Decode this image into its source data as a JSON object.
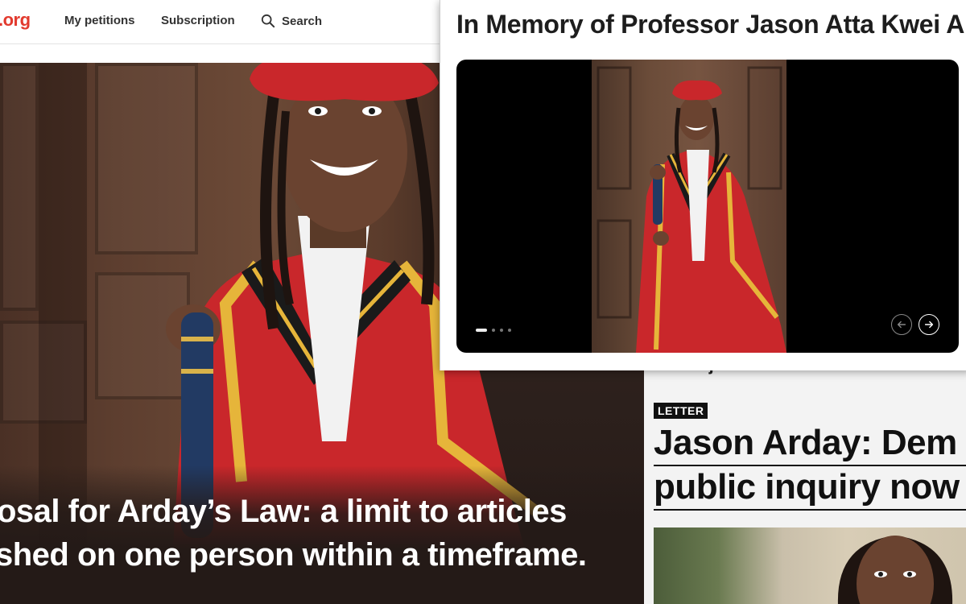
{
  "nav": {
    "logo_fragment": ".org",
    "links": [
      "My petitions",
      "Subscription",
      "Search"
    ]
  },
  "hero": {
    "caption_lines": [
      "osal for Arday’s Law: a limit to articles",
      "shed on one person within a timeframe."
    ]
  },
  "news": {
    "fragment": "Project",
    "badge": "LETTER",
    "headline_lines": [
      "Jason Arday: Dem",
      "public inquiry now"
    ]
  },
  "popup": {
    "title": "In Memory of Professor Jason Atta Kwei Ar",
    "carousel": {
      "slide_count": 4,
      "active_index": 0,
      "prev_icon": "arrow-left-icon",
      "next_icon": "arrow-right-icon"
    }
  },
  "colors": {
    "brand": "#e23a2e",
    "gown_red": "#c9272b",
    "gown_yellow": "#e6b53a",
    "gown_black": "#1a1a1a"
  }
}
